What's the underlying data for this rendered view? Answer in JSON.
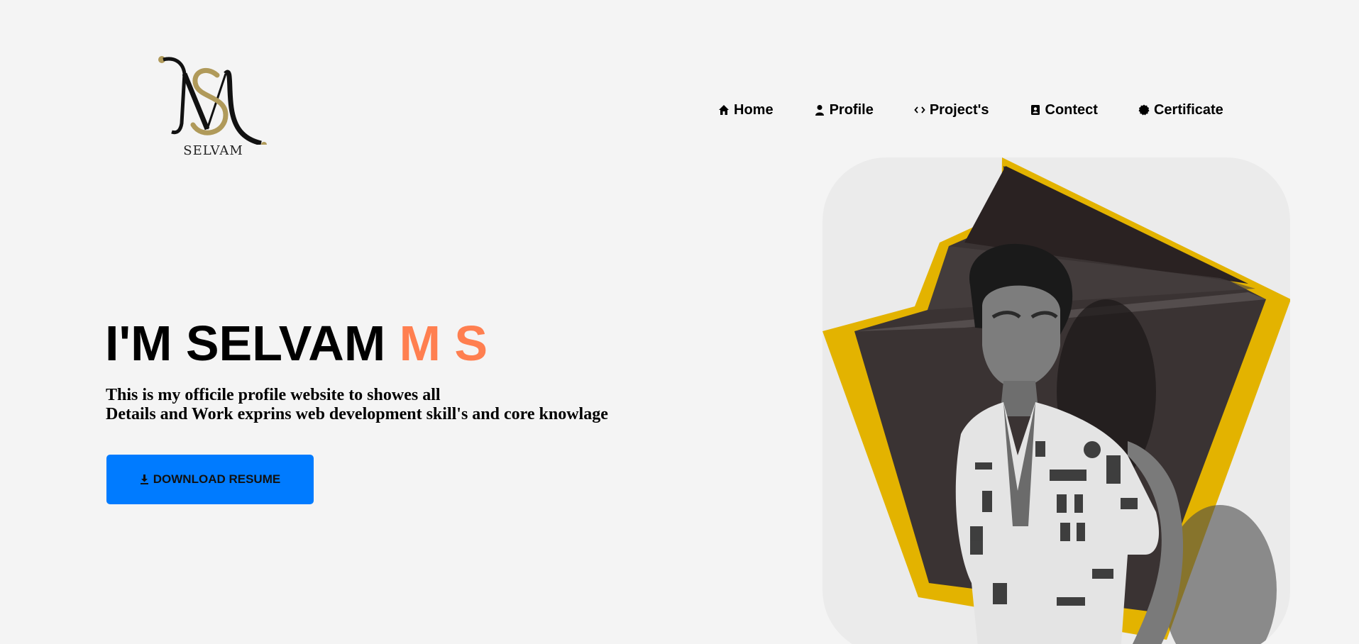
{
  "logo": {
    "monogram": "MS",
    "text": "SELVAM",
    "icon": "ms-monogram-logo",
    "colors": {
      "black": "#111111",
      "gold": "#b09a5a"
    }
  },
  "nav": {
    "items": [
      {
        "label": "Home",
        "icon": "home-icon"
      },
      {
        "label": "Profile",
        "icon": "user-icon"
      },
      {
        "label": "Project's",
        "icon": "code-icon"
      },
      {
        "label": "Contect",
        "icon": "contact-book-icon"
      },
      {
        "label": "Certificate",
        "icon": "certificate-badge-icon"
      }
    ]
  },
  "hero": {
    "title_prefix": "I'M SELVAM ",
    "title_accent": "M S",
    "description_line1": "This is my officile profile website to showes all",
    "description_line2": "Details and Work exprins web development skill's and core knowlage",
    "button_label": "DOWNLOAD RESUME",
    "button_icon": "download-icon"
  },
  "colors": {
    "background": "#f4f4f4",
    "accent": "#ff7f50",
    "button": "#007bff",
    "card": "#ebebeb",
    "frame_yellow": "#e3b300",
    "frame_dark": "#3a3333"
  }
}
